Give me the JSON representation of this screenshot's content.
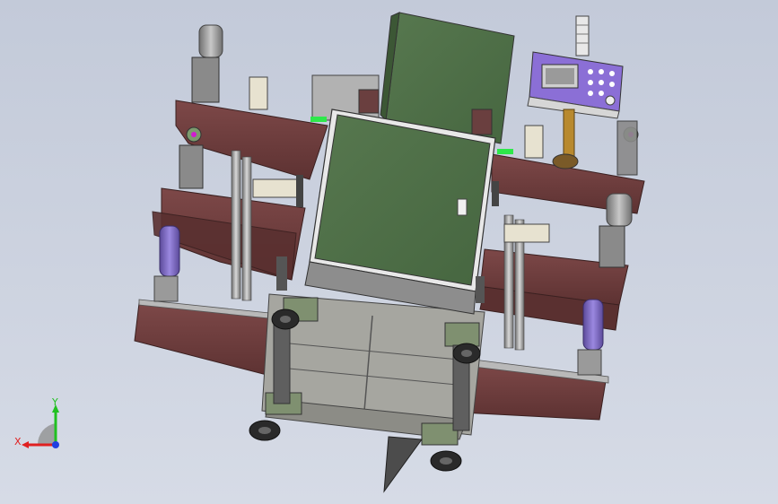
{
  "app": {
    "title": ""
  },
  "viewport": {
    "background_top": "#c3cad9",
    "background_bottom": "#d6dbe6",
    "model": {
      "frame_color": "#6b3a3a",
      "frame_highlight": "#7b4646",
      "cabinet_green": "#4f7048",
      "cabinet_border": "#e6e6e6",
      "steel_gray": "#8f8f8f",
      "dark_gray": "#5e5e5e",
      "cylinder_purple": "#7a63b8",
      "hmi_panel_color": "#8b6fd6",
      "indicator_green": "#2ee84a",
      "brass": "#b8892e"
    }
  },
  "triad": {
    "x_label": "X",
    "y_label": "Y",
    "x_color": "#e02020",
    "y_color": "#20c020",
    "z_color": "#2040e0"
  }
}
